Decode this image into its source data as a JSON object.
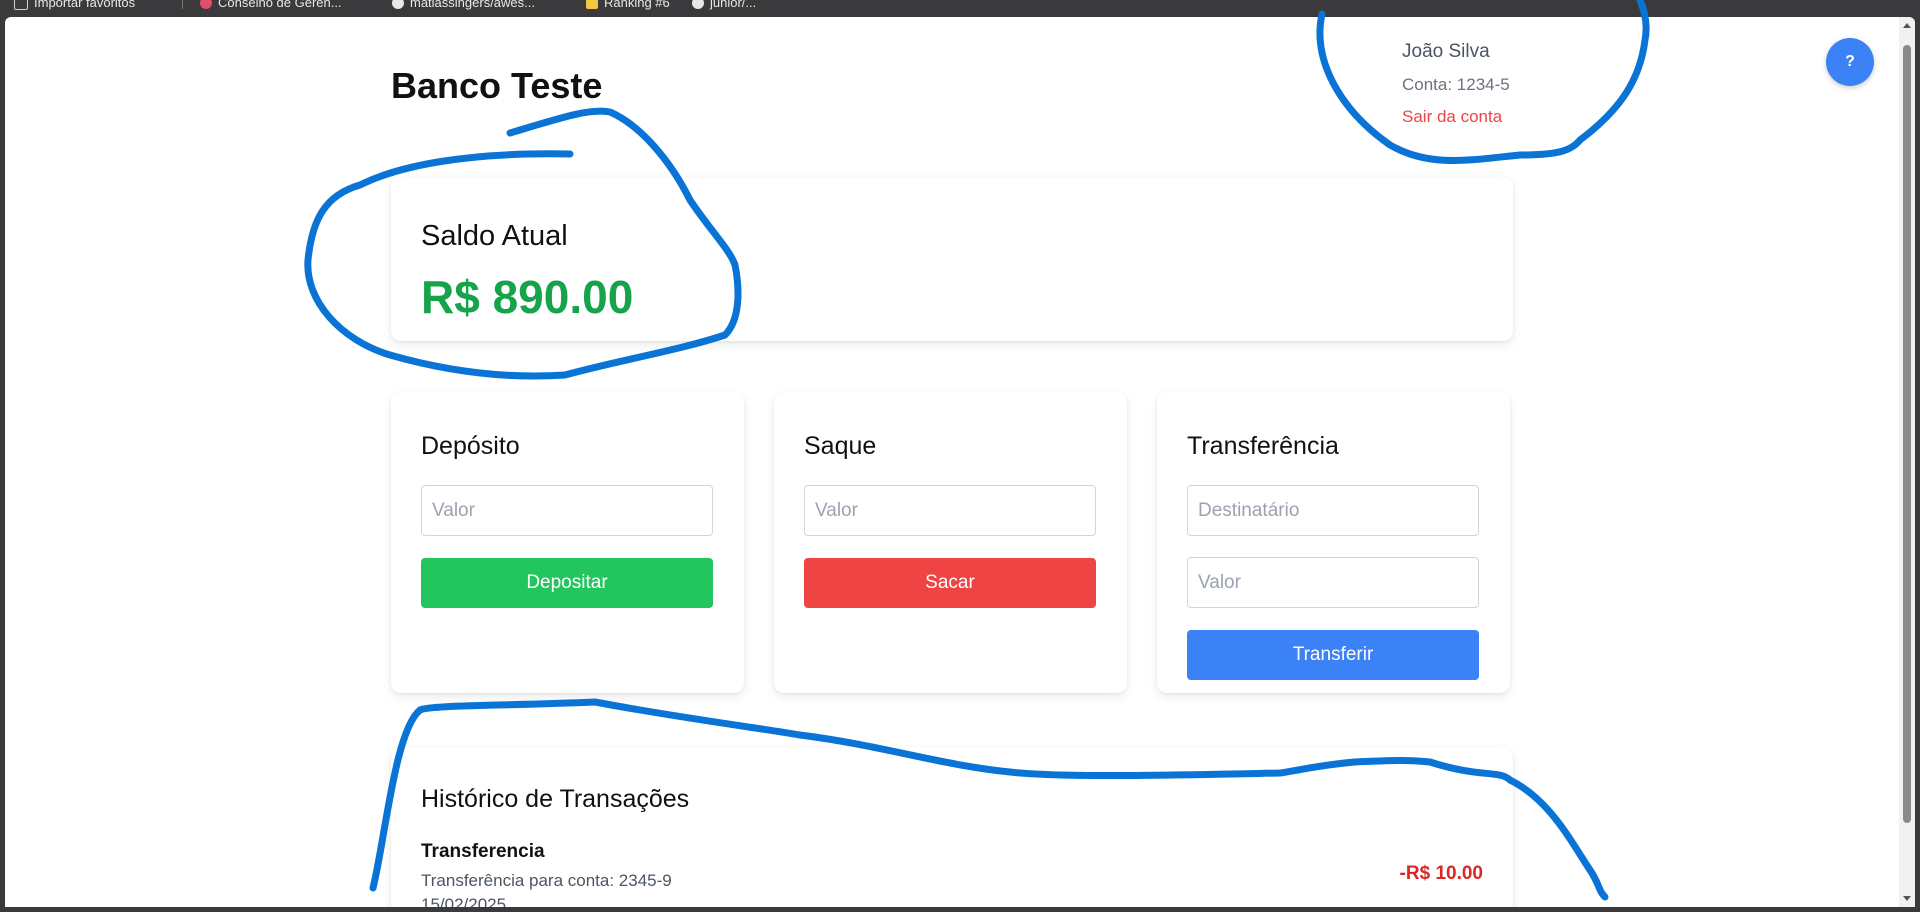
{
  "bookmarks": [
    {
      "label": "Importar favoritos",
      "icon": "import-icon",
      "color": "#cfcfcf"
    },
    {
      "label": "Conselho de Geren...",
      "icon": "site-icon",
      "color": "#e0506a"
    },
    {
      "label": "matiassingers/awes...",
      "icon": "github-icon",
      "color": "#e8e8e8"
    },
    {
      "label": "Ranking #6",
      "icon": "star-icon",
      "color": "#f2c744"
    },
    {
      "label": "junior/...",
      "icon": "github-icon",
      "color": "#e8e8e8"
    }
  ],
  "help": {
    "label": "?"
  },
  "app": {
    "title": "Banco Teste"
  },
  "user": {
    "name": "João Silva",
    "account": "Conta: 1234-5",
    "logout": "Sair da conta"
  },
  "balance": {
    "title": "Saldo Atual",
    "value": "R$ 890.00"
  },
  "deposit": {
    "title": "Depósito",
    "placeholder": "Valor",
    "button": "Depositar"
  },
  "withdraw": {
    "title": "Saque",
    "placeholder": "Valor",
    "button": "Sacar"
  },
  "transfer": {
    "title": "Transferência",
    "recipient_placeholder": "Destinatário",
    "amount_placeholder": "Valor",
    "button": "Transferir"
  },
  "history": {
    "title": "Histórico de Transações",
    "items": [
      {
        "type": "Transferencia",
        "description": "Transferência para conta: 2345-9",
        "date": "15/02/2025",
        "amount": "-R$ 10.00"
      }
    ]
  },
  "colors": {
    "balance": "#16a34a",
    "deposit": "#22c55e",
    "withdraw": "#ef4444",
    "transfer": "#3b82f6",
    "annotation": "#0a74d6"
  }
}
